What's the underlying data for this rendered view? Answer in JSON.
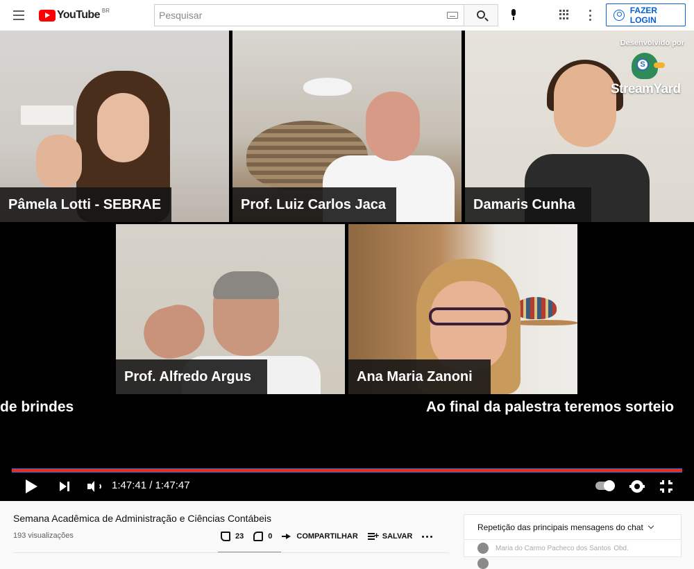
{
  "header": {
    "logo_text": "YouTube",
    "country_code": "BR",
    "search_placeholder": "Pesquisar",
    "login_label": "FAZER LOGIN"
  },
  "video": {
    "participants": [
      "Pâmela Lotti - SEBRAE",
      "Prof. Luiz Carlos Jaca",
      "Damaris Cunha",
      "Prof. Alfredo Argus",
      "Ana Maria Zanoni"
    ],
    "branding": {
      "developed_by": "Desenvolvido por",
      "brand": "StreamYard",
      "logo_letter": "S"
    },
    "ticker_left": "de brindes",
    "ticker_right": "Ao final da palestra teremos sorteio",
    "progress_fraction": 1.0,
    "time_display": "1:47:41 / 1:47:47",
    "colors": {
      "progress_played": "#e52d27",
      "progress_buffer": "#2f6fd6"
    }
  },
  "info": {
    "title": "Semana Acadêmica de Administração e Ciências Contábeis",
    "views": "193 visualizações",
    "like_count": "23",
    "dislike_count": "0",
    "share_label": "COMPARTILHAR",
    "save_label": "SALVAR"
  },
  "chat": {
    "header": "Repetição das principais mensagens do chat",
    "messages": [
      {
        "author": "Maria do Carmo Pacheco dos Santos",
        "text": "Obd."
      },
      {
        "author": "",
        "text": ""
      }
    ]
  }
}
